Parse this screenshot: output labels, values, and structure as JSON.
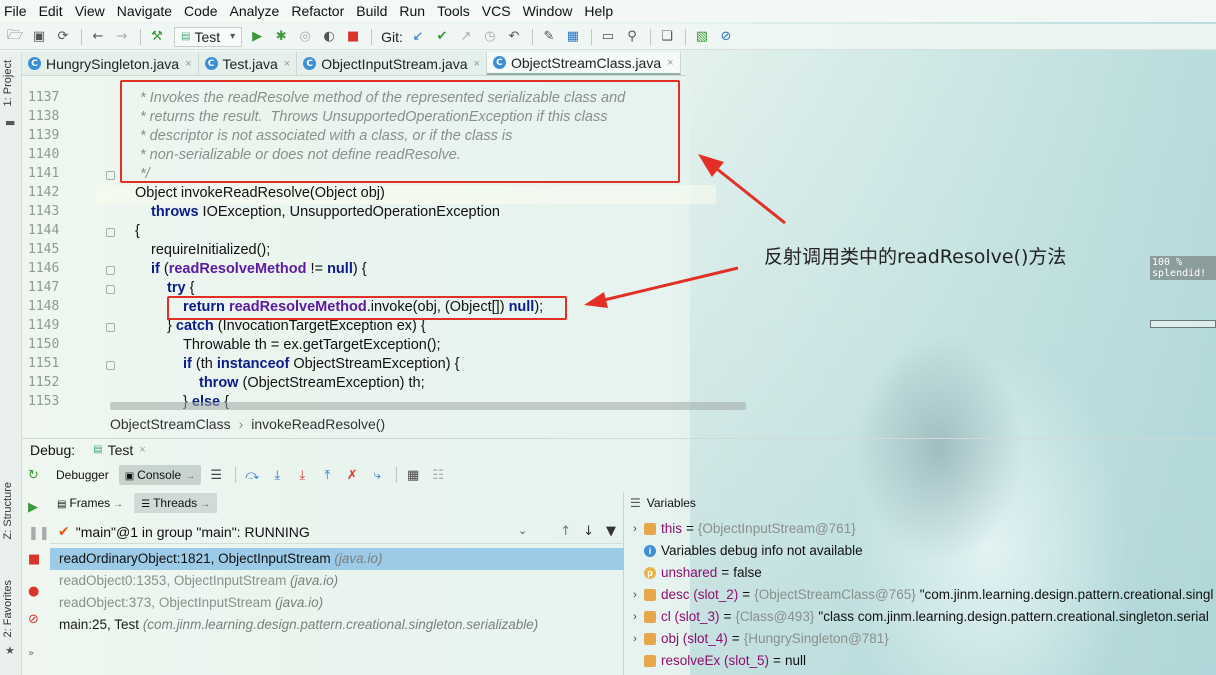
{
  "menu": [
    "File",
    "Edit",
    "View",
    "Navigate",
    "Code",
    "Analyze",
    "Refactor",
    "Build",
    "Run",
    "Tools",
    "VCS",
    "Window",
    "Help"
  ],
  "toolbar": {
    "run_config": "Test",
    "git_label": "Git:"
  },
  "left_strip": {
    "project": "1: Project",
    "structure": "Z: Structure",
    "favorites": "2: Favorites"
  },
  "editor_tabs": [
    {
      "label": "HungrySingleton.java",
      "icon": "C"
    },
    {
      "label": "Test.java",
      "icon": "C"
    },
    {
      "label": "ObjectInputStream.java",
      "icon": "C"
    },
    {
      "label": "ObjectStreamClass.java",
      "icon": "C",
      "active": true
    }
  ],
  "code": {
    "line_numbers": [
      "1137",
      "1138",
      "1139",
      "1140",
      "1141",
      "1142",
      "1143",
      "1144",
      "1145",
      "1146",
      "1147",
      "1148",
      "1149",
      "1150",
      "1151",
      "1152",
      "1153"
    ],
    "comment_1137": "* Invokes the readResolve method of the represented serializable class and",
    "comment_1138": "* returns the result.  Throws UnsupportedOperationException if this class",
    "comment_1139": "* descriptor is not associated with a class, or if the class is",
    "comment_1140": "* non-serializable or does not define readResolve.",
    "comment_1141": "*/",
    "l1142": "Object invokeReadResolve(Object obj)",
    "l1143_kw": "throws",
    "l1143_rest": " IOException, UnsupportedOperationException",
    "l1144": "{",
    "l1145": "requireInitialized();",
    "l1146_kw": "if",
    "l1146_a": " (",
    "l1146_fld": "readResolveMethod",
    "l1146_b": " != ",
    "l1146_null": "null",
    "l1146_c": ") {",
    "l1147_kw": "try",
    "l1147_rest": " {",
    "l1148_kw": "return",
    "l1148_fld": "readResolveMethod",
    "l1148_a": ".invoke(obj, (Object[]) ",
    "l1148_null": "null",
    "l1148_b": ");",
    "l1149_a": "} ",
    "l1149_kw": "catch",
    "l1149_rest": " (InvocationTargetException ex) {",
    "l1150": "Throwable th = ex.getTargetException();",
    "l1151_kw": "if",
    "l1151_a": " (th ",
    "l1151_kw2": "instanceof",
    "l1151_rest": " ObjectStreamException) {",
    "l1152_kw": "throw",
    "l1152_rest": " (ObjectStreamException) th;",
    "l1153_a": "} ",
    "l1153_kw": "else",
    "l1153_rest": " {"
  },
  "annotation": {
    "text": "反射调用类中的readResolve()方法",
    "color": "#e33026"
  },
  "breadcrumb": [
    "ObjectStreamClass",
    "invokeReadResolve()"
  ],
  "side_badge": {
    "line1": "100 %",
    "line2": "splendid!"
  },
  "debug": {
    "title": "Debug:",
    "session_tab": "Test",
    "tabs": {
      "debugger": "Debugger",
      "console": "Console"
    },
    "frames_tab": "Frames",
    "threads_tab": "Threads",
    "thread": "\"main\"@1 in group \"main\": RUNNING",
    "frames": [
      {
        "method": "readOrdinaryObject:1821, ObjectInputStream",
        "pkg": "(java.io)"
      },
      {
        "method": "readObject0:1353, ObjectInputStream",
        "pkg": "(java.io)"
      },
      {
        "method": "readObject:373, ObjectInputStream",
        "pkg": "(java.io)"
      },
      {
        "method": "main:25, Test",
        "pkg": "(com.jinm.learning.design.pattern.creational.singleton.serializable)"
      }
    ],
    "variables_title": "Variables",
    "variables": [
      {
        "name": "this",
        "ref": "{ObjectInputStream@761}",
        "value": ""
      },
      {
        "name": "",
        "ref": "",
        "value": "Variables debug info not available"
      },
      {
        "name": "unshared",
        "ref": "",
        "value": "false"
      },
      {
        "name": "desc (slot_2)",
        "ref": "{ObjectStreamClass@765}",
        "value": "\"com.jinm.learning.design.pattern.creational.singl"
      },
      {
        "name": "cl (slot_3)",
        "ref": "{Class@493}",
        "value": "\"class com.jinm.learning.design.pattern.creational.singleton.serial"
      },
      {
        "name": "obj (slot_4)",
        "ref": "{HungrySingleton@781}",
        "value": ""
      },
      {
        "name": "resolveEx (slot_5)",
        "ref": "",
        "value": "null"
      }
    ]
  }
}
